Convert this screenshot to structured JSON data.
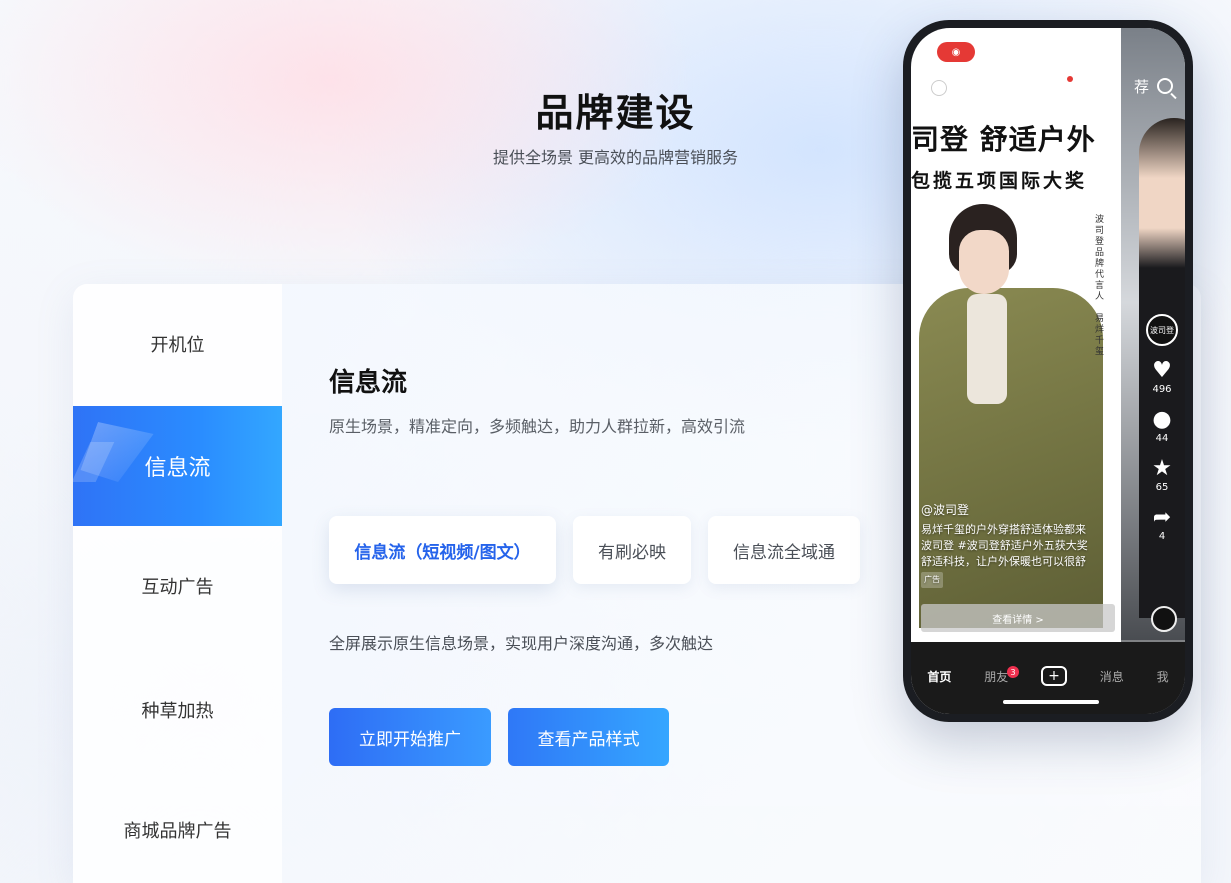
{
  "hero": {
    "title": "品牌建设",
    "subtitle": "提供全场景 更高效的品牌营销服务"
  },
  "sidebar": {
    "items": [
      {
        "label": "开机位"
      },
      {
        "label": "信息流",
        "active": true
      },
      {
        "label": "互动广告"
      },
      {
        "label": "种草加热"
      },
      {
        "label": "商城品牌广告"
      }
    ]
  },
  "content": {
    "title": "信息流",
    "description": "原生场景，精准定向，多频触达，助力人群拉新，高效引流",
    "tabs": [
      {
        "label": "信息流（短视频/图文）",
        "active": true
      },
      {
        "label": "有刷必映"
      },
      {
        "label": "信息流全域通"
      }
    ],
    "tab_description": "全屏展示原生信息场景，实现用户深度沟通，多次触达",
    "primary_button": "立即开始推广",
    "secondary_button": "查看产品样式"
  },
  "phone": {
    "top_tab": "荐",
    "ad_headline": "司登 舒适户外",
    "ad_subheadline": "包揽五项国际大奖",
    "vertical_text": "波司登品牌代言人　易烊千玺",
    "avatar_text": "波司登",
    "likes": "496",
    "comments": "44",
    "favorites": "65",
    "shares": "4",
    "username": "@波司登",
    "caption_line1": "易烊千玺的户外穿搭舒适体验都来",
    "caption_line2": "波司登 #波司登舒适户外五获大奖",
    "caption_line3": "舒适科技，让户外保暖也可以很舒",
    "ad_tag": "广告",
    "detail_button": "查看详情 >",
    "nav": {
      "home": "首页",
      "friends": "朋友",
      "friends_badge": "3",
      "messages": "消息",
      "me": "我"
    }
  },
  "colors": {
    "accent": "#2f73f6",
    "accent_light": "#33a7ff",
    "active_tab_text": "#2563eb"
  }
}
